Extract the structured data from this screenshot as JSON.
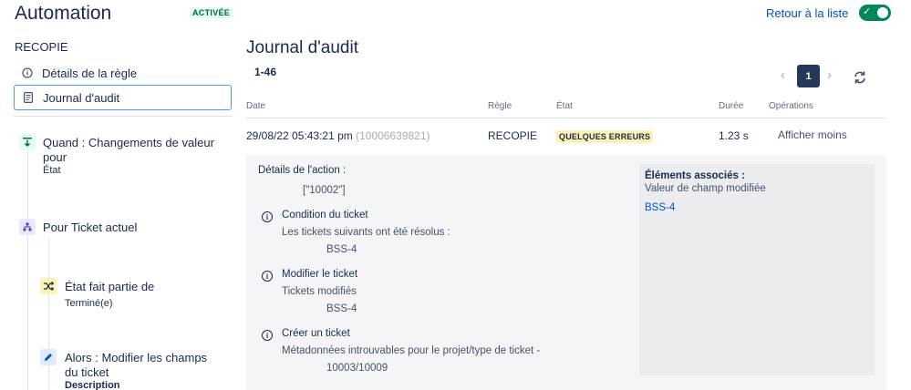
{
  "header": {
    "title": "Automation",
    "status_badge": "ACTIVÉE",
    "back_link": "Retour à la liste",
    "toggle_state": "on"
  },
  "sidebar": {
    "rule_name": "RECOPIE",
    "nav": [
      {
        "label": "Détails de la règle",
        "icon": "info-icon",
        "selected": false
      },
      {
        "label": "Journal d'audit",
        "icon": "document-icon",
        "selected": true
      }
    ],
    "steps": [
      {
        "title": "Quand : Changements de valeur pour",
        "sub": "État",
        "icon": "trigger-icon"
      },
      {
        "title": "Pour Ticket actuel",
        "sub": "",
        "icon": "branch-icon"
      },
      {
        "title": "État fait partie de",
        "sub": "Terminé(e)",
        "icon": "shuffle-icon"
      },
      {
        "title": "Alors : Modifier les champs du ticket",
        "sub": "Description",
        "icon": "pencil-icon"
      }
    ]
  },
  "main": {
    "title": "Journal d'audit",
    "range": "1-46",
    "pagination": {
      "current": "1"
    },
    "columns": [
      "Date",
      "Règle",
      "État",
      "Durée",
      "Opérations"
    ],
    "row": {
      "date": "29/08/22 05:43:21 pm",
      "id": "(10006639821)",
      "rule": "RECOPIE",
      "status": "QUELQUES ERREURS",
      "duration": "1.23 s",
      "operation": "Afficher moins"
    },
    "details": {
      "heading": "Détails de l'action :",
      "value": "[\"10002\"]",
      "items": [
        {
          "title": "Condition du ticket",
          "desc": "Les tickets suivants ont été résolus :",
          "value": "BSS-4"
        },
        {
          "title": "Modifier le ticket",
          "desc": "Tickets modifiés",
          "value": "BSS-4"
        },
        {
          "title": "Créer un ticket",
          "desc": "Métadonnées introuvables pour le projet/type de ticket -",
          "value": "10003/10009"
        }
      ]
    },
    "associated": {
      "heading": "Éléments associés :",
      "sub": "Valeur de champ modifiée",
      "link": "BSS-4"
    }
  },
  "colors": {
    "accent": "#0052cc",
    "success": "#00875a",
    "warning_bg": "#fff0b3",
    "focus": "#4c9aff"
  }
}
